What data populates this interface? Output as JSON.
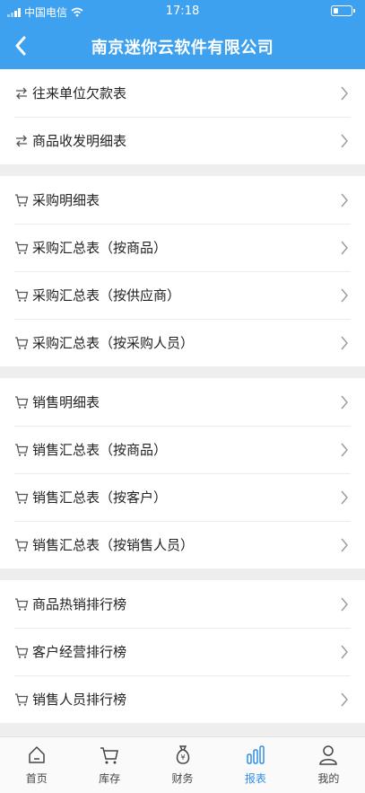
{
  "status_bar": {
    "carrier": "中国电信",
    "time": "17:18"
  },
  "header": {
    "title": "南京迷你云软件有限公司"
  },
  "groups": [
    {
      "items": [
        {
          "label": "往来单位欠款表",
          "icon": "transfer-icon"
        },
        {
          "label": "商品收发明细表",
          "icon": "transfer-icon"
        }
      ]
    },
    {
      "items": [
        {
          "label": "采购明细表",
          "icon": "cart-icon"
        },
        {
          "label": "采购汇总表（按商品）",
          "icon": "cart-icon"
        },
        {
          "label": "采购汇总表（按供应商）",
          "icon": "cart-icon"
        },
        {
          "label": "采购汇总表（按采购人员）",
          "icon": "cart-icon"
        }
      ]
    },
    {
      "items": [
        {
          "label": "销售明细表",
          "icon": "cart-icon"
        },
        {
          "label": "销售汇总表（按商品）",
          "icon": "cart-icon"
        },
        {
          "label": "销售汇总表（按客户）",
          "icon": "cart-icon"
        },
        {
          "label": "销售汇总表（按销售人员）",
          "icon": "cart-icon"
        }
      ]
    },
    {
      "items": [
        {
          "label": "商品热销排行榜",
          "icon": "cart-icon"
        },
        {
          "label": "客户经营排行榜",
          "icon": "cart-icon"
        },
        {
          "label": "销售人员排行榜",
          "icon": "cart-icon"
        }
      ]
    }
  ],
  "tabs": [
    {
      "label": "首页",
      "icon": "home-icon"
    },
    {
      "label": "库存",
      "icon": "cart-icon"
    },
    {
      "label": "财务",
      "icon": "money-bag-icon"
    },
    {
      "label": "报表",
      "icon": "bar-chart-icon",
      "active": true
    },
    {
      "label": "我的",
      "icon": "user-icon"
    }
  ],
  "colors": {
    "header_bg": "#3da1f0",
    "active_tab": "#2e8fe6"
  }
}
